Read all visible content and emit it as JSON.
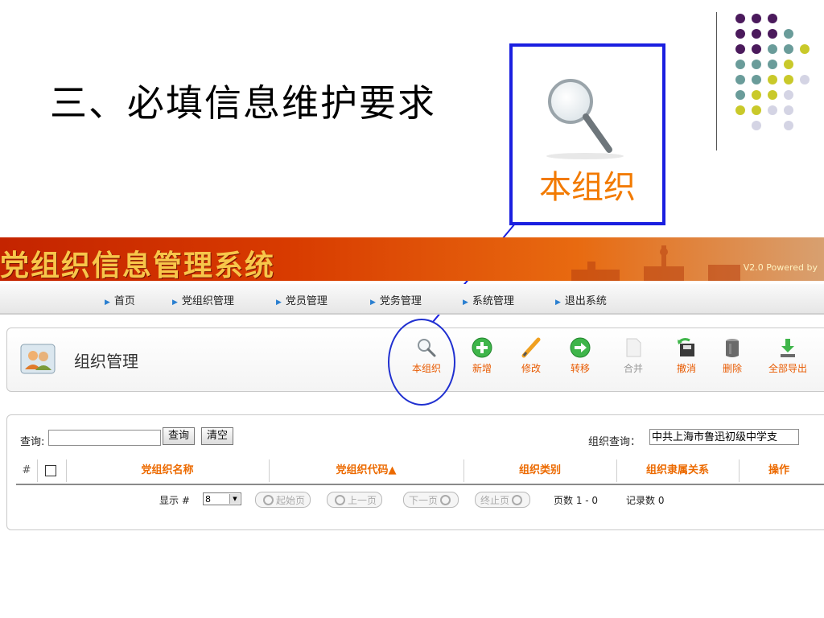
{
  "slide_title": "三、必填信息维护要求",
  "zoom_callout": {
    "label": "本组织",
    "icon": "magnifier-icon"
  },
  "banner": {
    "title": "党组织信息管理系统",
    "version": "V2.0   Powered by"
  },
  "nav": [
    {
      "label": "首页"
    },
    {
      "label": "党组织管理"
    },
    {
      "label": "党员管理"
    },
    {
      "label": "党务管理"
    },
    {
      "label": "系统管理"
    },
    {
      "label": "退出系统"
    }
  ],
  "panel": {
    "title": "组织管理",
    "icon": "org-people-icon"
  },
  "toolbar": [
    {
      "label": "本组织",
      "icon": "magnifier-icon"
    },
    {
      "label": "新增",
      "icon": "plus-circle-icon"
    },
    {
      "label": "修改",
      "icon": "pencil-icon"
    },
    {
      "label": "转移",
      "icon": "arrow-circle-icon"
    },
    {
      "label": "合并",
      "icon": "document-icon"
    },
    {
      "label": "撤消",
      "icon": "undo-disk-icon"
    },
    {
      "label": "删除",
      "icon": "trash-icon"
    },
    {
      "label": "全部导出",
      "icon": "download-icon"
    }
  ],
  "search": {
    "label": "查询:",
    "value": "",
    "query_button": "查询",
    "clear_button": "清空"
  },
  "org_query": {
    "label": "组织查询：",
    "value": "中共上海市鲁迅初级中学支"
  },
  "table": {
    "headers": [
      "#",
      "党组织名称",
      "党组织代码▲",
      "组织类别",
      "组织隶属关系",
      "操作"
    ]
  },
  "pagination": {
    "display_label": "显示 #",
    "page_size": "8",
    "first": "起始页",
    "prev": "上一页",
    "next": "下一页",
    "last": "终止页",
    "pages_text": "页数 1 - 0",
    "records_text": "记录数 0"
  },
  "colors": {
    "accent_orange": "#ec6a00",
    "highlight_blue": "#1a1fe0",
    "banner_red": "#c42400"
  }
}
